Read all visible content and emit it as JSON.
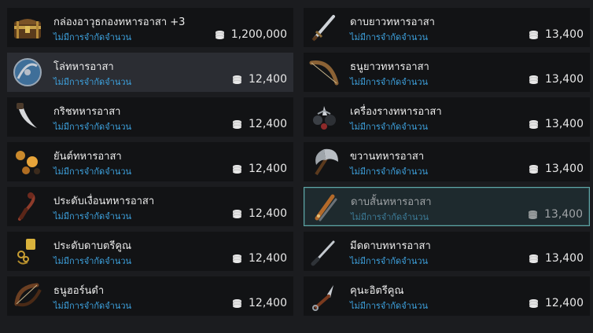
{
  "shop": {
    "items": [
      {
        "name": "กล่องอาวุธกองทหารอาสา +3",
        "limit": "ไม่มีการจำกัดจำนวน",
        "price": "1,200,000",
        "icon": "chest-icon"
      },
      {
        "name": "ดาบยาวทหารอาสา",
        "limit": "ไม่มีการจำกัดจำนวน",
        "price": "13,400",
        "icon": "longsword-icon"
      },
      {
        "name": "โล่ทหารอาสา",
        "limit": "ไม่มีการจำกัดจำนวน",
        "price": "12,400",
        "icon": "shield-icon"
      },
      {
        "name": "ธนูยาวทหารอาสา",
        "limit": "ไม่มีการจำกัดจำนวน",
        "price": "13,400",
        "icon": "longbow-icon"
      },
      {
        "name": "กริชทหารอาสา",
        "limit": "ไม่มีการจำกัดจำนวน",
        "price": "12,400",
        "icon": "dagger-icon"
      },
      {
        "name": "เครื่องรางทหารอาสา",
        "limit": "ไม่มีการจำกัดจำนวน",
        "price": "13,400",
        "icon": "talisman-icon"
      },
      {
        "name": "ยันต์ทหารอาสา",
        "limit": "ไม่มีการจำกัดจำนวน",
        "price": "12,400",
        "icon": "amulet-icon"
      },
      {
        "name": "ขวานทหารอาสา",
        "limit": "ไม่มีการจำกัดจำนวน",
        "price": "13,400",
        "icon": "axe-icon"
      },
      {
        "name": "ประดับเงื่อนทหารอาสา",
        "limit": "ไม่มีการจำกัดจำนวน",
        "price": "12,400",
        "icon": "ornament-knot-icon"
      },
      {
        "name": "ดาบสั้นทหารอาสา",
        "limit": "ไม่มีการจำกัดจำนวน",
        "price": "13,400",
        "icon": "shortswords-icon"
      },
      {
        "name": "ประดับดาบตรีคูณ",
        "limit": "ไม่มีการจำกัดจำนวน",
        "price": "12,400",
        "icon": "sword-ornament-icon"
      },
      {
        "name": "มีดดาบทหารอาสา",
        "limit": "ไม่มีการจำกัดจำนวน",
        "price": "13,400",
        "icon": "blade-icon"
      },
      {
        "name": "ธนูฮอร์นดำ",
        "limit": "ไม่มีการจำกัดจำนวน",
        "price": "12,400",
        "icon": "horn-bow-icon"
      },
      {
        "name": "คุนะอิตรีคูณ",
        "limit": "ไม่มีการจำกัดจำนวน",
        "price": "12,400",
        "icon": "kunai-icon"
      }
    ],
    "hovered_index": 2,
    "selected_index": 9,
    "currency_icon": "silver-coin-stack-icon"
  },
  "colors": {
    "limit_text": "#3ea3e0",
    "selected_border": "#5fa7a8",
    "background": "#1b1c1f"
  }
}
